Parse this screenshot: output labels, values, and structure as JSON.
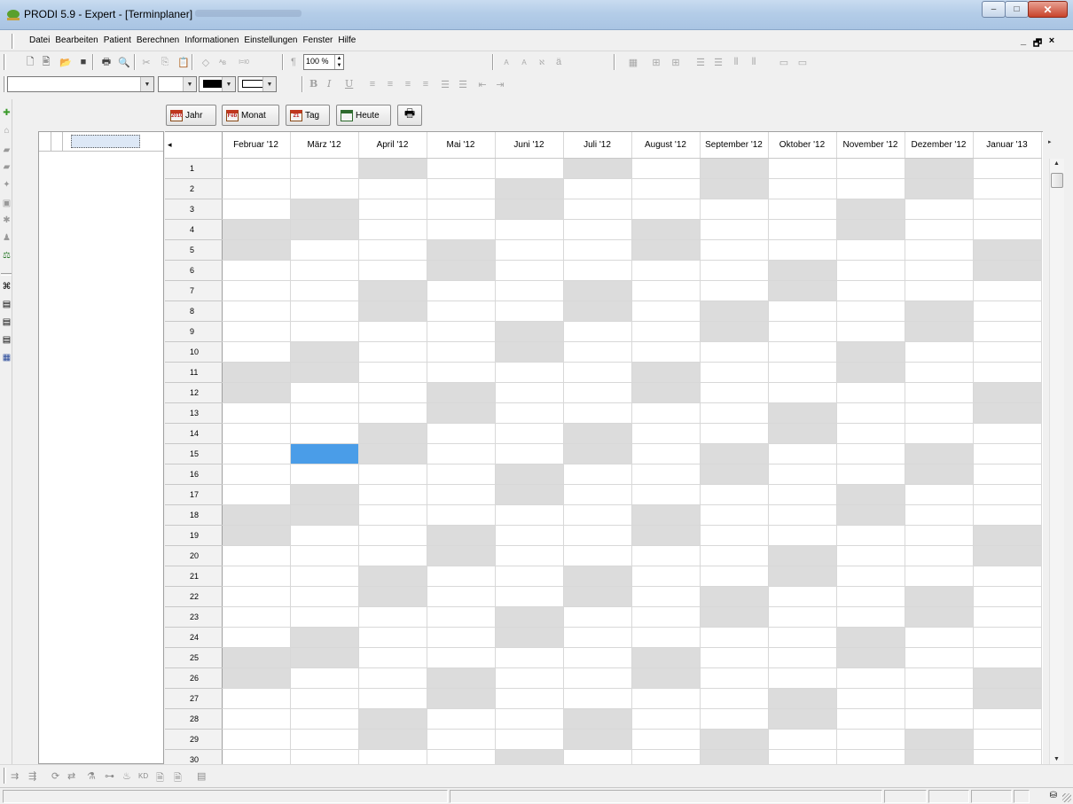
{
  "window": {
    "title": "PRODI 5.9 - Expert - [Terminplaner]",
    "controls": {
      "minimize": "–",
      "maximize": "□",
      "close": "✕"
    }
  },
  "menu": {
    "items": [
      "Datei",
      "Bearbeiten",
      "Patient",
      "Berechnen",
      "Informationen",
      "Einstellungen",
      "Fenster",
      "Hilfe"
    ],
    "mdi_controls": [
      "_",
      "🗗",
      "×"
    ]
  },
  "toolbar": {
    "zoom_value": "100 %",
    "format_labels": {
      "bold": "B",
      "italic": "I",
      "underline": "U"
    }
  },
  "view_buttons": {
    "year": {
      "label": "Jahr",
      "icon_text": "2010"
    },
    "month": {
      "label": "Monat",
      "icon_text": "Feb"
    },
    "day": {
      "label": "Tag",
      "icon_text": "21"
    },
    "today": {
      "label": "Heute"
    },
    "print_icon": "printer-icon"
  },
  "calendar": {
    "months": [
      "Februar '12",
      "März '12",
      "April '12",
      "Mai '12",
      "Juni '12",
      "Juli '12",
      "August '12",
      "September '12",
      "Oktober '12",
      "November '12",
      "Dezember '12",
      "Januar '13"
    ],
    "days": [
      1,
      2,
      3,
      4,
      5,
      6,
      7,
      8,
      9,
      10,
      11,
      12,
      13,
      14,
      15,
      16,
      17,
      18,
      19,
      20,
      21,
      22,
      23,
      24,
      25,
      26,
      27,
      28,
      29,
      30
    ],
    "weekend_days": [
      [
        4,
        5,
        11,
        12,
        18,
        19,
        25,
        26
      ],
      [
        3,
        4,
        10,
        11,
        17,
        18,
        24,
        25
      ],
      [
        1,
        7,
        8,
        14,
        15,
        21,
        22,
        28,
        29
      ],
      [
        5,
        6,
        12,
        13,
        19,
        20,
        26,
        27
      ],
      [
        2,
        3,
        9,
        10,
        16,
        17,
        23,
        24,
        30
      ],
      [
        1,
        7,
        8,
        14,
        15,
        21,
        22,
        28,
        29
      ],
      [
        4,
        5,
        11,
        12,
        18,
        19,
        25,
        26
      ],
      [
        1,
        2,
        8,
        9,
        15,
        16,
        22,
        23,
        29,
        30
      ],
      [
        6,
        7,
        13,
        14,
        20,
        21,
        27,
        28
      ],
      [
        3,
        4,
        10,
        11,
        17,
        18,
        24,
        25
      ],
      [
        1,
        2,
        8,
        9,
        15,
        16,
        22,
        23,
        29,
        30
      ],
      [
        5,
        6,
        12,
        13,
        19,
        20,
        26,
        27
      ]
    ],
    "selected": {
      "month_index": 1,
      "day": 15
    },
    "colors": {
      "weekend": "#dcdcdc",
      "selected": "#4a9de8"
    }
  }
}
